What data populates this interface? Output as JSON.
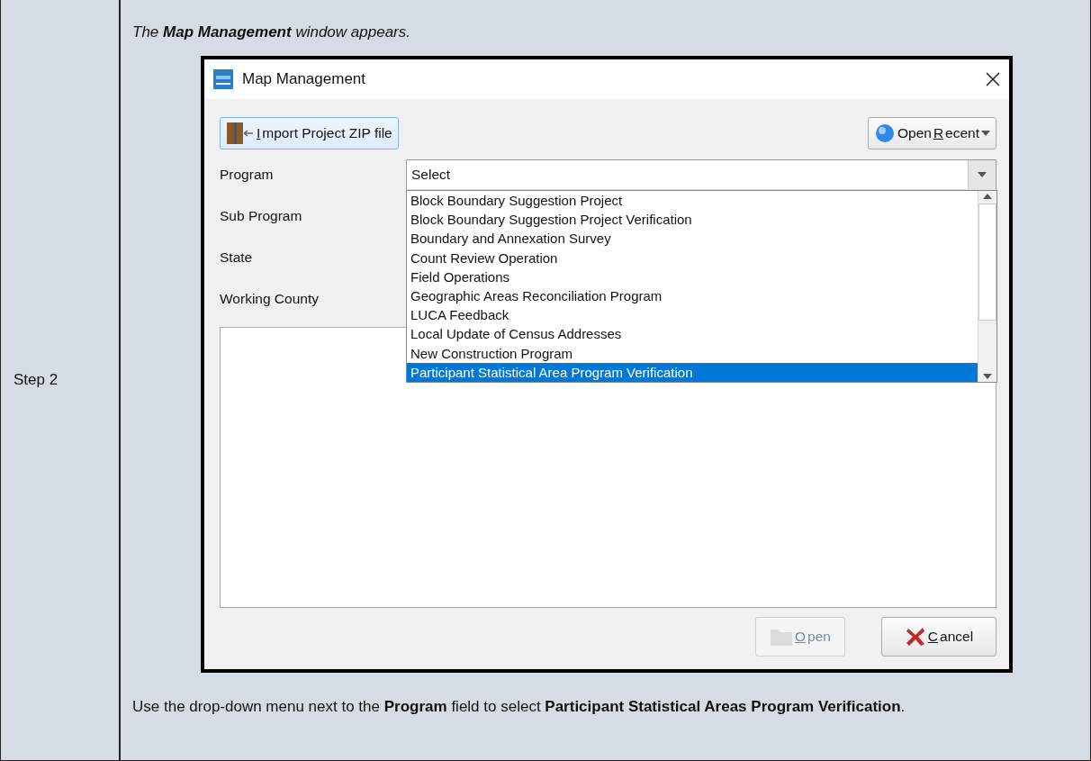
{
  "step": {
    "label": "Step 2"
  },
  "intro": "The **Map Management** window appears.",
  "window": {
    "title": "Map Management",
    "import_button": {
      "key": "I",
      "after": "mport Project ZIP file"
    },
    "recent_button": {
      "before": "Open ",
      "key": "R",
      "after": "ecent"
    },
    "fields": [
      {
        "label": "Program",
        "value": "Select",
        "expanded": true
      },
      {
        "label": "Sub Program"
      },
      {
        "label": "State"
      },
      {
        "label": "Working County"
      }
    ],
    "dropdown": [
      {
        "label": "Block Boundary Suggestion Project",
        "selected": false
      },
      {
        "label": "Block Boundary Suggestion Project Verification",
        "selected": false
      },
      {
        "label": "Boundary and Annexation Survey",
        "selected": false
      },
      {
        "label": "Count Review Operation",
        "selected": false
      },
      {
        "label": "Field Operations",
        "selected": false
      },
      {
        "label": "Geographic Areas Reconciliation Program",
        "selected": false
      },
      {
        "label": "LUCA Feedback",
        "selected": false
      },
      {
        "label": "Local Update of Census Addresses",
        "selected": false
      },
      {
        "label": "New Construction Program",
        "selected": false
      },
      {
        "label": "Participant Statistical Area Program Verification",
        "selected": true
      }
    ],
    "buttons": [
      {
        "kind": "open",
        "key": "O",
        "after": "pen",
        "disabled": true
      },
      {
        "kind": "cancel",
        "key": "C",
        "after": "ancel",
        "disabled": false
      }
    ]
  },
  "instruction": "Use the drop-down menu next to the **Program** field to select **Participant Statistical Areas Program Verification**."
}
